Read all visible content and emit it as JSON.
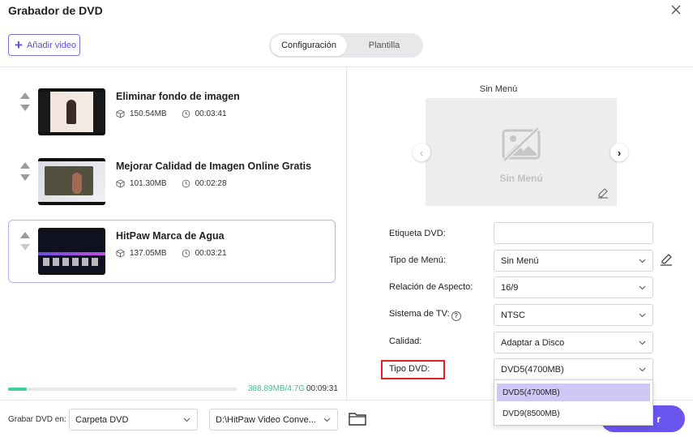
{
  "window": {
    "title": "Grabador de DVD"
  },
  "header": {
    "add_video_label": "Añadir video",
    "tabs": [
      {
        "label": "Configuración",
        "active": true
      },
      {
        "label": "Plantilla",
        "active": false
      }
    ]
  },
  "videos": [
    {
      "name": "Eliminar fondo de imagen",
      "size": "150.54MB",
      "duration": "00:03:41"
    },
    {
      "name": "Mejorar Calidad de Imagen Online Gratis",
      "size": "101.30MB",
      "duration": "00:02:28"
    },
    {
      "name": "HitPaw Marca de Agua",
      "size": "137.05MB",
      "duration": "00:03:21"
    }
  ],
  "storage": {
    "used_label": "388.89MB/4.7G",
    "total_time": "00:09:31",
    "used_fraction": 0.08
  },
  "preview": {
    "title": "Sin Menú",
    "placeholder_text": "Sin Menú"
  },
  "settings": {
    "dvd_label": {
      "label": "Etiqueta DVD:",
      "value": ""
    },
    "menu_type": {
      "label": "Tipo de Menú:",
      "value": "Sin Menú"
    },
    "aspect_ratio": {
      "label": "Relación de Aspecto:",
      "value": "16/9"
    },
    "tv_system": {
      "label": "Sistema de TV:",
      "value": "NTSC"
    },
    "quality": {
      "label": "Calidad:",
      "value": "Adaptar a Disco"
    },
    "dvd_type": {
      "label": "Tipo DVD:",
      "value": "DVD5(4700MB)",
      "options": [
        "DVD5(4700MB)",
        "DVD9(8500MB)"
      ]
    }
  },
  "footer": {
    "burn_to_label": "Grabar DVD en:",
    "destination": "Carpeta DVD",
    "path": "D:\\HitPaw Video Conve...",
    "burn_button": "r"
  },
  "colors": {
    "accent": "#6a55ee",
    "highlight": "#e02424",
    "progress": "#3fd09a"
  }
}
